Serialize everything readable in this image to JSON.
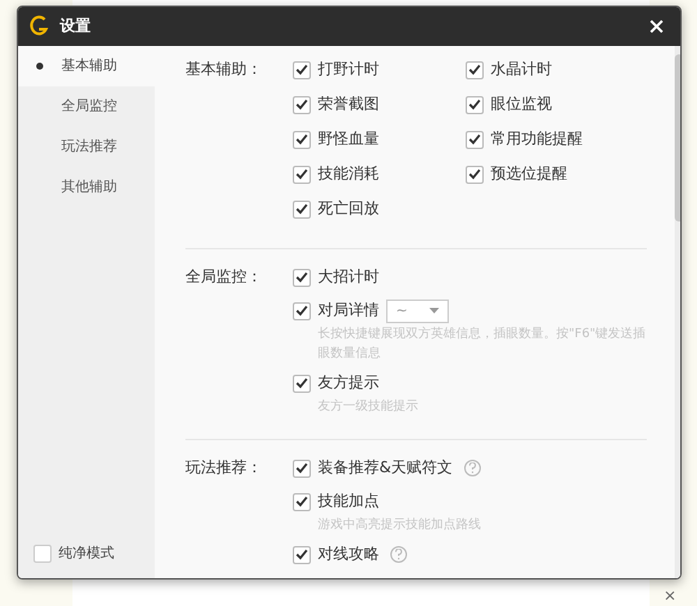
{
  "window": {
    "title": "设置"
  },
  "sidebar": {
    "items": [
      {
        "label": "基本辅助",
        "selected": true
      },
      {
        "label": "全局监控",
        "selected": false
      },
      {
        "label": "玩法推荐",
        "selected": false
      },
      {
        "label": "其他辅助",
        "selected": false
      }
    ],
    "footer": {
      "label": "纯净模式",
      "checked": false
    }
  },
  "sections": [
    {
      "title": "基本辅助：",
      "kind": "grid",
      "options": [
        {
          "label": "打野计时",
          "checked": true
        },
        {
          "label": "水晶计时",
          "checked": true
        },
        {
          "label": "荣誉截图",
          "checked": true
        },
        {
          "label": "眼位监视",
          "checked": true
        },
        {
          "label": "野怪血量",
          "checked": true
        },
        {
          "label": "常用功能提醒",
          "checked": true
        },
        {
          "label": "技能消耗",
          "checked": true
        },
        {
          "label": "预选位提醒",
          "checked": true
        },
        {
          "label": "死亡回放",
          "checked": true
        }
      ]
    },
    {
      "title": "全局监控：",
      "kind": "list",
      "options": [
        {
          "label": "大招计时",
          "checked": true
        },
        {
          "label": "对局详情",
          "checked": true,
          "dropdown": "~",
          "hint": "长按快捷键展现双方英雄信息，插眼数量。按\"F6\"键发送插眼数量信息"
        },
        {
          "label": "友方提示",
          "checked": true,
          "hint": "友方一级技能提示"
        }
      ]
    },
    {
      "title": "玩法推荐：",
      "kind": "list",
      "options": [
        {
          "label": "装备推荐&天赋符文",
          "checked": true,
          "help": true
        },
        {
          "label": "技能加点",
          "checked": true,
          "hint": "游戏中高亮提示技能加点路线"
        },
        {
          "label": "对线攻略",
          "checked": true,
          "help": true
        }
      ]
    }
  ],
  "background": {
    "close_glyph": "×"
  }
}
